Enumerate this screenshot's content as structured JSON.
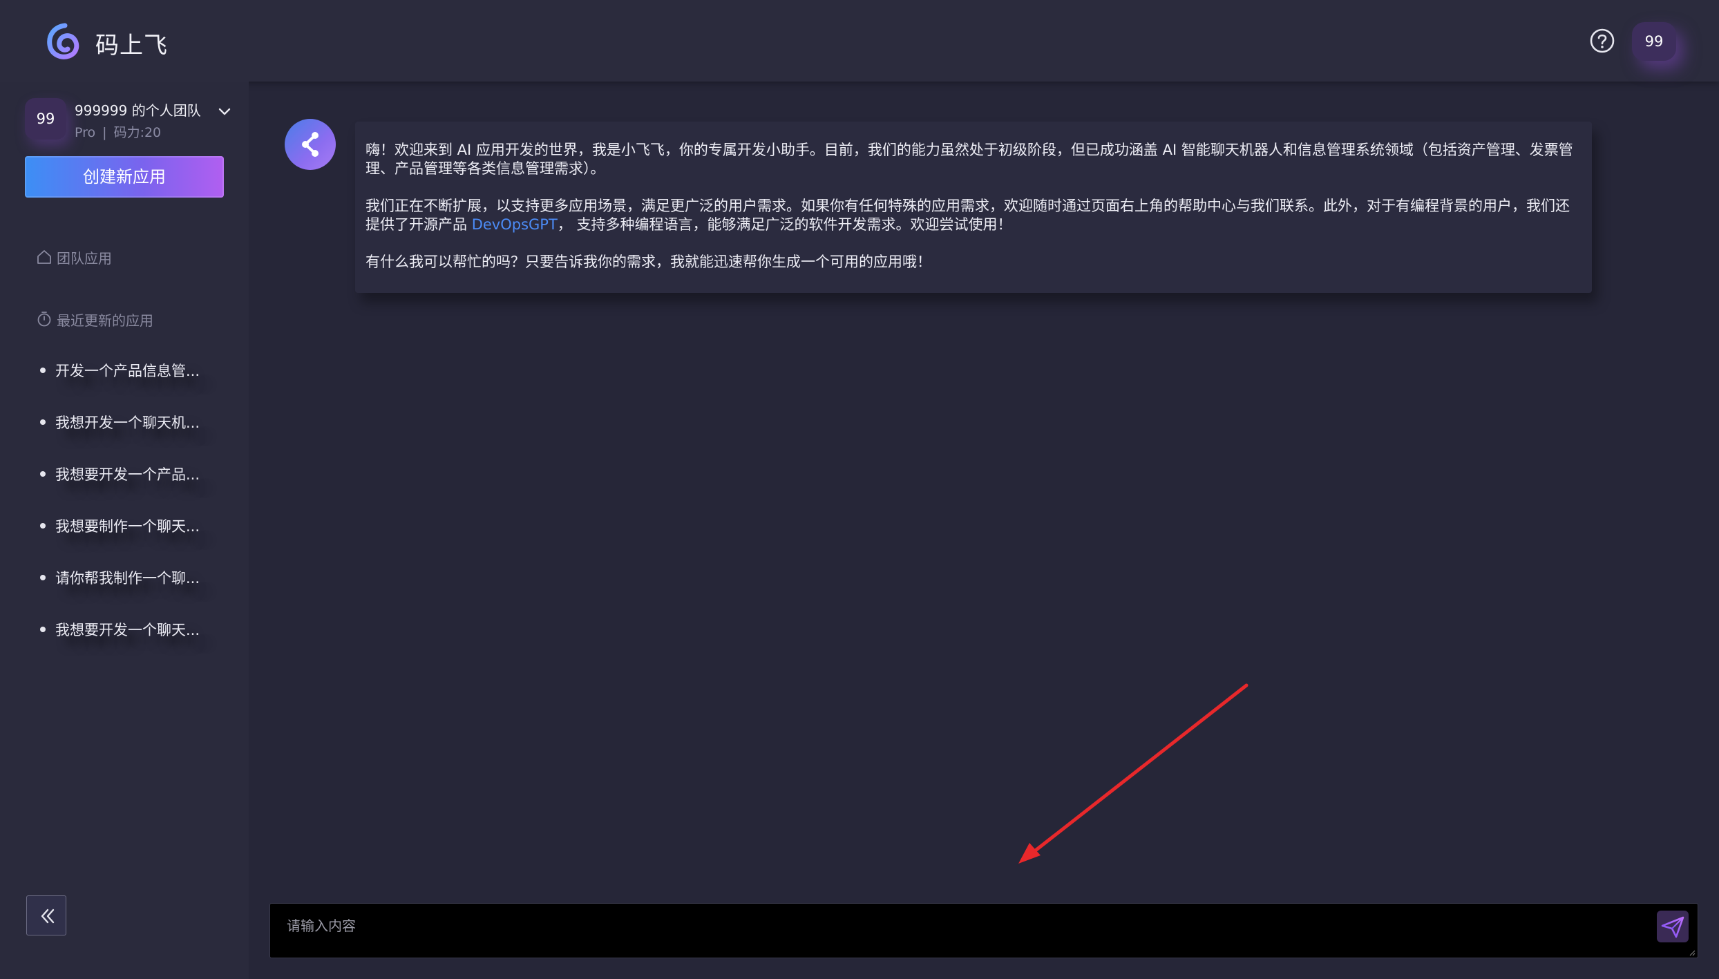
{
  "header": {
    "app_name": "码上飞",
    "help_icon": "help-circle-icon",
    "avatar_text": "99"
  },
  "sidebar": {
    "team": {
      "avatar_text": "99",
      "name": "999999 的个人团队",
      "plan": "Pro",
      "separator": "|",
      "power": "码力:20"
    },
    "create_button": "创建新应用",
    "nav": {
      "team_apps": "团队应用",
      "recent_apps": "最近更新的应用"
    },
    "recent": [
      {
        "label": "开发一个产品信息管..."
      },
      {
        "label": "我想开发一个聊天机..."
      },
      {
        "label": "我想要开发一个产品..."
      },
      {
        "label": "我想要制作一个聊天..."
      },
      {
        "label": "请你帮我制作一个聊..."
      },
      {
        "label": "我想要开发一个聊天..."
      }
    ]
  },
  "chat": {
    "message_p1": "嗨！欢迎来到 AI 应用开发的世界，我是小飞飞，你的专属开发小助手。目前，我们的能力虽然处于初级阶段，但已成功涵盖 AI 智能聊天机器人和信息管理系统领域（包括资产管理、发票管理、产品管理等各类信息管理需求）。",
    "message_p2_before": "我们正在不断扩展，以支持更多应用场景，满足更广泛的用户需求。如果你有任何特殊的应用需求，欢迎随时通过页面右上角的帮助中心与我们联系。此外，对于有编程背景的用户，我们还提供了开源产品 ",
    "message_p2_link": "DevOpsGPT",
    "message_p2_after": "， 支持多种编程语言，能够满足广泛的软件开发需求。欢迎尝试使用！",
    "message_p3": "有什么我可以帮忙的吗？只要告诉我你的需求，我就能迅速帮你生成一个可用的应用哦！"
  },
  "input": {
    "placeholder": "请输入内容",
    "value": ""
  },
  "colors": {
    "background": "#262638",
    "accent_link": "#4c8cf7",
    "arrow": "#e8282b"
  }
}
